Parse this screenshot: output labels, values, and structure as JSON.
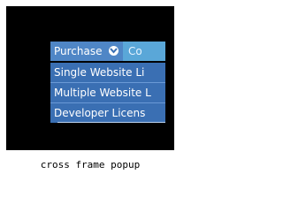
{
  "menu": {
    "top_items": [
      {
        "label": "Purchase",
        "has_submenu": true,
        "icon": "chevron-down-icon"
      },
      {
        "label": "Co"
      }
    ],
    "dropdown_items": [
      {
        "label": "Single Website Li"
      },
      {
        "label": "Multiple Website L"
      },
      {
        "label": "Developer Licens"
      }
    ],
    "colors": {
      "frame": "#000000",
      "top_item_active": "#4f86c6",
      "top_item_next": "#5aa7d8",
      "dropdown_item": "#3a6fb3",
      "text": "#ffffff"
    }
  },
  "caption": "cross frame popup"
}
